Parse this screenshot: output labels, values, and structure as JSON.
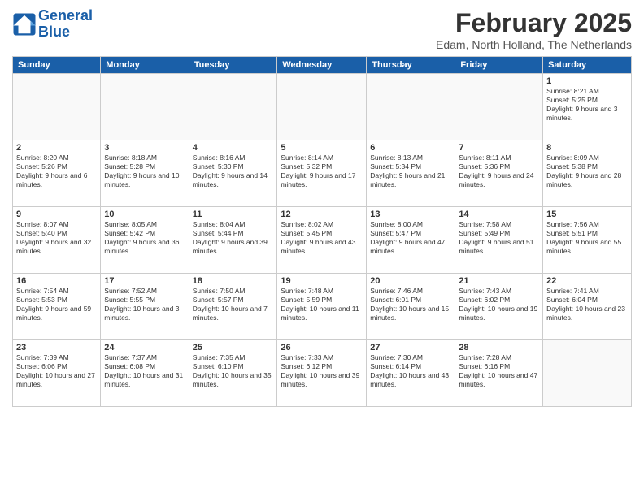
{
  "header": {
    "logo_line1": "General",
    "logo_line2": "Blue",
    "title": "February 2025",
    "location": "Edam, North Holland, The Netherlands"
  },
  "days_of_week": [
    "Sunday",
    "Monday",
    "Tuesday",
    "Wednesday",
    "Thursday",
    "Friday",
    "Saturday"
  ],
  "weeks": [
    [
      {
        "day": "",
        "info": "",
        "empty": true
      },
      {
        "day": "",
        "info": "",
        "empty": true
      },
      {
        "day": "",
        "info": "",
        "empty": true
      },
      {
        "day": "",
        "info": "",
        "empty": true
      },
      {
        "day": "",
        "info": "",
        "empty": true
      },
      {
        "day": "",
        "info": "",
        "empty": true
      },
      {
        "day": "1",
        "info": "Sunrise: 8:21 AM\nSunset: 5:25 PM\nDaylight: 9 hours and 3 minutes."
      }
    ],
    [
      {
        "day": "2",
        "info": "Sunrise: 8:20 AM\nSunset: 5:26 PM\nDaylight: 9 hours and 6 minutes."
      },
      {
        "day": "3",
        "info": "Sunrise: 8:18 AM\nSunset: 5:28 PM\nDaylight: 9 hours and 10 minutes."
      },
      {
        "day": "4",
        "info": "Sunrise: 8:16 AM\nSunset: 5:30 PM\nDaylight: 9 hours and 14 minutes."
      },
      {
        "day": "5",
        "info": "Sunrise: 8:14 AM\nSunset: 5:32 PM\nDaylight: 9 hours and 17 minutes."
      },
      {
        "day": "6",
        "info": "Sunrise: 8:13 AM\nSunset: 5:34 PM\nDaylight: 9 hours and 21 minutes."
      },
      {
        "day": "7",
        "info": "Sunrise: 8:11 AM\nSunset: 5:36 PM\nDaylight: 9 hours and 24 minutes."
      },
      {
        "day": "8",
        "info": "Sunrise: 8:09 AM\nSunset: 5:38 PM\nDaylight: 9 hours and 28 minutes."
      }
    ],
    [
      {
        "day": "9",
        "info": "Sunrise: 8:07 AM\nSunset: 5:40 PM\nDaylight: 9 hours and 32 minutes."
      },
      {
        "day": "10",
        "info": "Sunrise: 8:05 AM\nSunset: 5:42 PM\nDaylight: 9 hours and 36 minutes."
      },
      {
        "day": "11",
        "info": "Sunrise: 8:04 AM\nSunset: 5:44 PM\nDaylight: 9 hours and 39 minutes."
      },
      {
        "day": "12",
        "info": "Sunrise: 8:02 AM\nSunset: 5:45 PM\nDaylight: 9 hours and 43 minutes."
      },
      {
        "day": "13",
        "info": "Sunrise: 8:00 AM\nSunset: 5:47 PM\nDaylight: 9 hours and 47 minutes."
      },
      {
        "day": "14",
        "info": "Sunrise: 7:58 AM\nSunset: 5:49 PM\nDaylight: 9 hours and 51 minutes."
      },
      {
        "day": "15",
        "info": "Sunrise: 7:56 AM\nSunset: 5:51 PM\nDaylight: 9 hours and 55 minutes."
      }
    ],
    [
      {
        "day": "16",
        "info": "Sunrise: 7:54 AM\nSunset: 5:53 PM\nDaylight: 9 hours and 59 minutes."
      },
      {
        "day": "17",
        "info": "Sunrise: 7:52 AM\nSunset: 5:55 PM\nDaylight: 10 hours and 3 minutes."
      },
      {
        "day": "18",
        "info": "Sunrise: 7:50 AM\nSunset: 5:57 PM\nDaylight: 10 hours and 7 minutes."
      },
      {
        "day": "19",
        "info": "Sunrise: 7:48 AM\nSunset: 5:59 PM\nDaylight: 10 hours and 11 minutes."
      },
      {
        "day": "20",
        "info": "Sunrise: 7:46 AM\nSunset: 6:01 PM\nDaylight: 10 hours and 15 minutes."
      },
      {
        "day": "21",
        "info": "Sunrise: 7:43 AM\nSunset: 6:02 PM\nDaylight: 10 hours and 19 minutes."
      },
      {
        "day": "22",
        "info": "Sunrise: 7:41 AM\nSunset: 6:04 PM\nDaylight: 10 hours and 23 minutes."
      }
    ],
    [
      {
        "day": "23",
        "info": "Sunrise: 7:39 AM\nSunset: 6:06 PM\nDaylight: 10 hours and 27 minutes."
      },
      {
        "day": "24",
        "info": "Sunrise: 7:37 AM\nSunset: 6:08 PM\nDaylight: 10 hours and 31 minutes."
      },
      {
        "day": "25",
        "info": "Sunrise: 7:35 AM\nSunset: 6:10 PM\nDaylight: 10 hours and 35 minutes."
      },
      {
        "day": "26",
        "info": "Sunrise: 7:33 AM\nSunset: 6:12 PM\nDaylight: 10 hours and 39 minutes."
      },
      {
        "day": "27",
        "info": "Sunrise: 7:30 AM\nSunset: 6:14 PM\nDaylight: 10 hours and 43 minutes."
      },
      {
        "day": "28",
        "info": "Sunrise: 7:28 AM\nSunset: 6:16 PM\nDaylight: 10 hours and 47 minutes."
      },
      {
        "day": "",
        "info": "",
        "empty": true
      }
    ]
  ]
}
